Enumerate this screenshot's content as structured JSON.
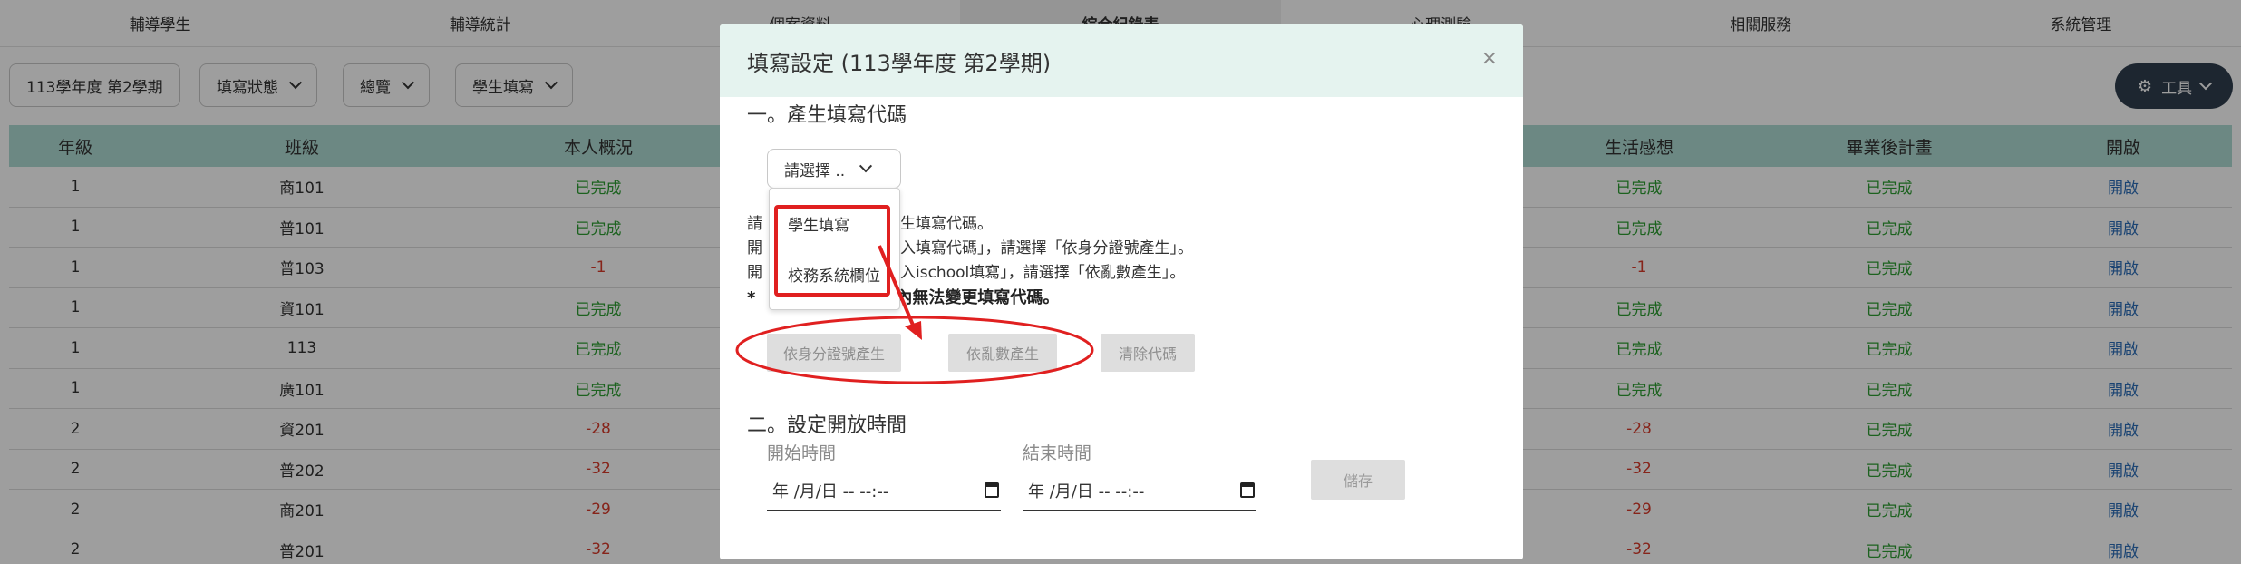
{
  "nav": [
    "輔導學生",
    "輔導統計",
    "個案資料",
    "綜合紀錄表",
    "心理測驗",
    "相關服務",
    "系統管理"
  ],
  "toolbar": {
    "semester": "113學年度 第2學期",
    "status": "填寫狀態",
    "overview": "總覽",
    "student_fill": "學生填寫",
    "tools": "工具"
  },
  "table": {
    "headers": {
      "grade": "年級",
      "class": "班級",
      "overview": "本人概況",
      "life": "生活感想",
      "plan": "畢業後計畫",
      "open": "開啟"
    },
    "rows": [
      {
        "grade": "1",
        "class": "商101",
        "overview": "已完成",
        "life": "已完成",
        "plan": "已完成",
        "open": "開啟"
      },
      {
        "grade": "1",
        "class": "普101",
        "overview": "已完成",
        "life": "已完成",
        "plan": "已完成",
        "open": "開啟"
      },
      {
        "grade": "1",
        "class": "普103",
        "overview": "-1",
        "life": "-1",
        "plan": "已完成",
        "open": "開啟"
      },
      {
        "grade": "1",
        "class": "資101",
        "overview": "已完成",
        "life": "已完成",
        "plan": "已完成",
        "open": "開啟"
      },
      {
        "grade": "1",
        "class": "113",
        "overview": "已完成",
        "life": "已完成",
        "plan": "已完成",
        "open": "開啟"
      },
      {
        "grade": "1",
        "class": "廣101",
        "overview": "已完成",
        "life": "已完成",
        "plan": "已完成",
        "open": "開啟"
      },
      {
        "grade": "2",
        "class": "資201",
        "overview": "-28",
        "life": "-28",
        "plan": "已完成",
        "open": "開啟"
      },
      {
        "grade": "2",
        "class": "普202",
        "overview": "-32",
        "life": "-32",
        "plan": "已完成",
        "open": "開啟"
      },
      {
        "grade": "2",
        "class": "商201",
        "overview": "-29",
        "life": "-29",
        "plan": "已完成",
        "open": "開啟"
      },
      {
        "grade": "2",
        "class": "普201",
        "overview": "-32",
        "life": "-32",
        "plan": "已完成",
        "open": "開啟"
      }
    ]
  },
  "modal": {
    "title": "填寫設定 (113學年度 第2學期)",
    "close": "×",
    "section1": "一。產生填寫代碼",
    "select_placeholder": "請選擇 ..",
    "dropdown": [
      "學生填寫",
      "校務系統欄位"
    ],
    "info": [
      "請",
      "生填寫代碼。",
      "開",
      "入填寫代碼」，請選擇「依身分證號產生」。",
      "開",
      "入ischool填寫」，請選擇「依亂數產生」。"
    ],
    "note_star": "*",
    "note": "內無法變更填寫代碼。",
    "btn_id": "依身分證號產生",
    "btn_random": "依亂數產生",
    "btn_clear": "清除代碼",
    "section2": "二。設定開放時間",
    "start_label": "開始時間",
    "end_label": "結束時間",
    "date_placeholder": "年 /月/日 -- --:--",
    "save": "儲存"
  },
  "colors": {
    "header_bg": "#aedbd3",
    "modal_header_bg": "#e5f3ef",
    "done": "#2e9e33",
    "negative": "#d83a2b",
    "link": "#2a6db8",
    "annotation": "#e02020"
  }
}
